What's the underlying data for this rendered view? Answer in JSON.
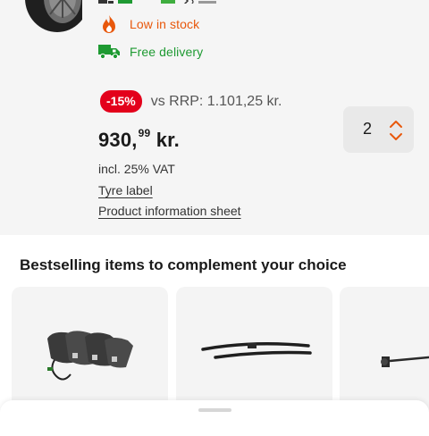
{
  "product": {
    "status": {
      "stock_text": "Low in stock",
      "delivery_text": "Free delivery"
    },
    "price": {
      "discount_badge": "-15%",
      "rrp_text": "vs RRP: 1.101,25 kr.",
      "main": "930,",
      "cents": "99",
      "currency": "kr.",
      "vat_text": "incl. 25% VAT"
    },
    "links": {
      "tyre_label": "Tyre label",
      "info_sheet": "Product information sheet"
    },
    "quantity": {
      "value": "2"
    }
  },
  "recommendations": {
    "title": "Bestselling items to complement your choice",
    "items": [
      {
        "icon": "brake-pads-icon"
      },
      {
        "icon": "wiper-blades-icon"
      },
      {
        "icon": "sensor-cable-icon"
      }
    ]
  },
  "colors": {
    "accent_orange": "#e8580c",
    "delivery_green": "#1e9a32",
    "discount_red": "#e3001b"
  }
}
